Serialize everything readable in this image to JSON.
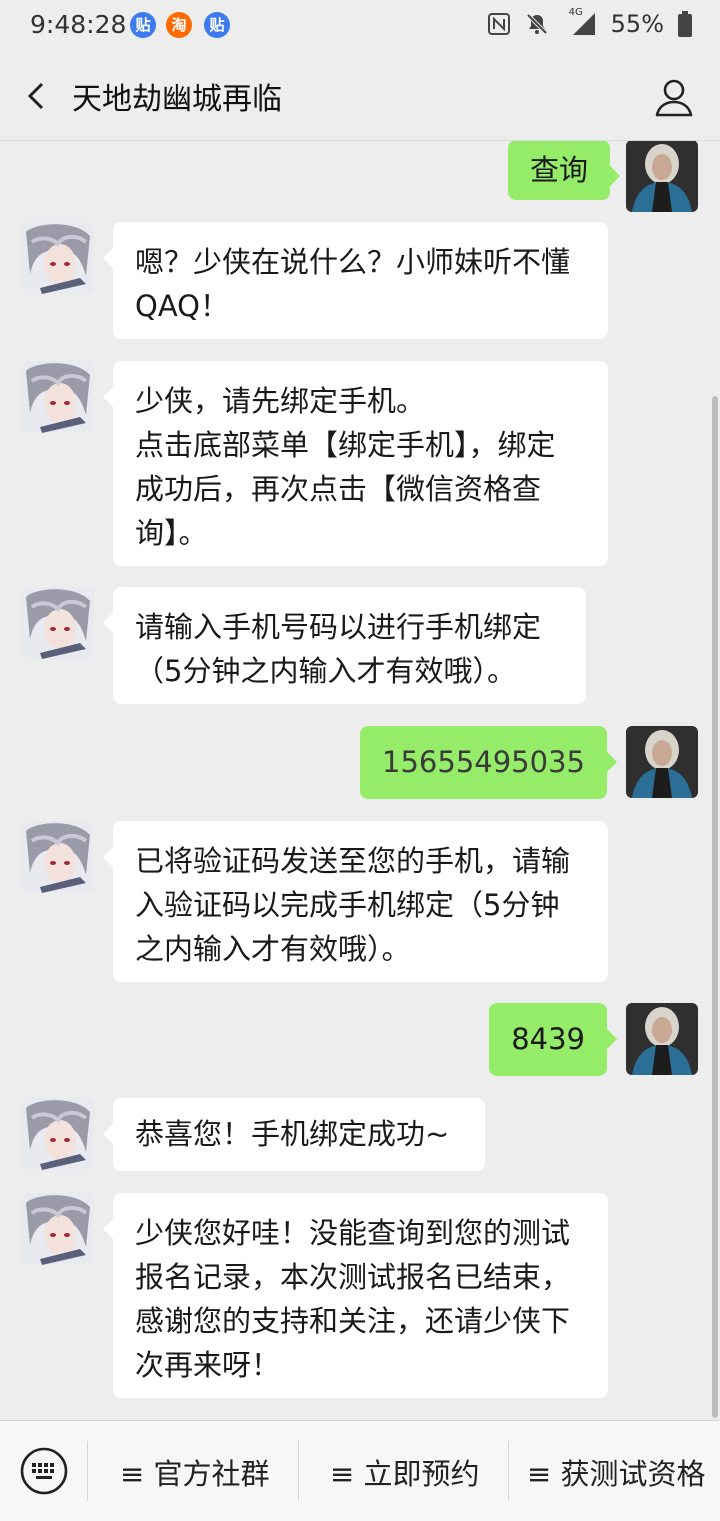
{
  "status_bar": {
    "time": "9:48:28",
    "notification_apps": [
      {
        "icon": "tieba-icon",
        "glyph": "贴",
        "color": "#3e7bef"
      },
      {
        "icon": "taobao-icon",
        "glyph": "淘",
        "color": "#ff6a00"
      },
      {
        "icon": "tieba-icon",
        "glyph": "贴",
        "color": "#3e7bef"
      }
    ],
    "network": "4G",
    "battery": "55%"
  },
  "header": {
    "title": "天地劫幽城再临",
    "back_icon": "chevron-left-icon",
    "profile_icon": "person-icon"
  },
  "messages": [
    {
      "side": "out",
      "text": "查询"
    },
    {
      "side": "in",
      "text": "嗯？少侠在说什么？小师妹听不懂\nQAQ！"
    },
    {
      "side": "in",
      "text": "少侠，请先绑定手机。\n点击底部菜单【绑定手机】，绑定\n成功后，再次点击【微信资格查\n询】。"
    },
    {
      "side": "in",
      "text": "请输入手机号码以进行手机绑定\n（5分钟之内输入才有效哦）。"
    },
    {
      "side": "out",
      "text": "15655495035"
    },
    {
      "side": "in",
      "text": "已将验证码发送至您的手机，请输\n入验证码以完成手机绑定（5分钟\n之内输入才有效哦）。"
    },
    {
      "side": "out",
      "text": "8439"
    },
    {
      "side": "in",
      "text": "恭喜您！手机绑定成功~"
    },
    {
      "side": "in",
      "text": "少侠您好哇！没能查询到您的测试\n报名记录，本次测试报名已结束，\n感谢您的支持和关注，还请少侠下\n次再来呀！"
    }
  ],
  "bottom_menu": {
    "keyboard_icon": "keyboard-icon",
    "items": [
      {
        "label": "≡ 官方社群"
      },
      {
        "label": "≡ 立即预约"
      },
      {
        "label": "≡ 获测试资格"
      }
    ]
  },
  "colors": {
    "background": "#ededed",
    "outgoing_bubble": "#95ec69",
    "incoming_bubble": "#ffffff"
  }
}
